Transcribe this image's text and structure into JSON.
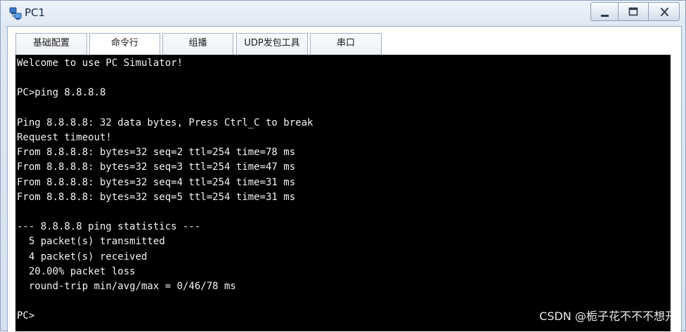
{
  "window": {
    "title": "PC1",
    "app_icon": "pc-simulator-icon",
    "controls": {
      "minimize_icon": "minimize-icon",
      "maximize_icon": "maximize-icon",
      "close_icon": "close-icon"
    }
  },
  "tabs": [
    {
      "label": "基础配置",
      "active": false
    },
    {
      "label": "命令行",
      "active": true
    },
    {
      "label": "组播",
      "active": false
    },
    {
      "label": "UDP发包工具",
      "active": false
    },
    {
      "label": "串口",
      "active": false
    }
  ],
  "console": {
    "lines": [
      "Welcome to use PC Simulator!",
      "",
      "PC>ping 8.8.8.8",
      "",
      "Ping 8.8.8.8: 32 data bytes, Press Ctrl_C to break",
      "Request timeout!",
      "From 8.8.8.8: bytes=32 seq=2 ttl=254 time=78 ms",
      "From 8.8.8.8: bytes=32 seq=3 ttl=254 time=47 ms",
      "From 8.8.8.8: bytes=32 seq=4 ttl=254 time=31 ms",
      "From 8.8.8.8: bytes=32 seq=5 ttl=254 time=31 ms",
      "",
      "--- 8.8.8.8 ping statistics ---",
      "  5 packet(s) transmitted",
      "  4 packet(s) received",
      "  20.00% packet loss",
      "  round-trip min/avg/max = 0/46/78 ms",
      "",
      "PC>"
    ]
  },
  "watermark": "CSDN @栀子花不不不想开",
  "colors": {
    "console_bg": "#000000",
    "console_fg": "#f2f2f2",
    "title_text": "#1b2c44"
  }
}
